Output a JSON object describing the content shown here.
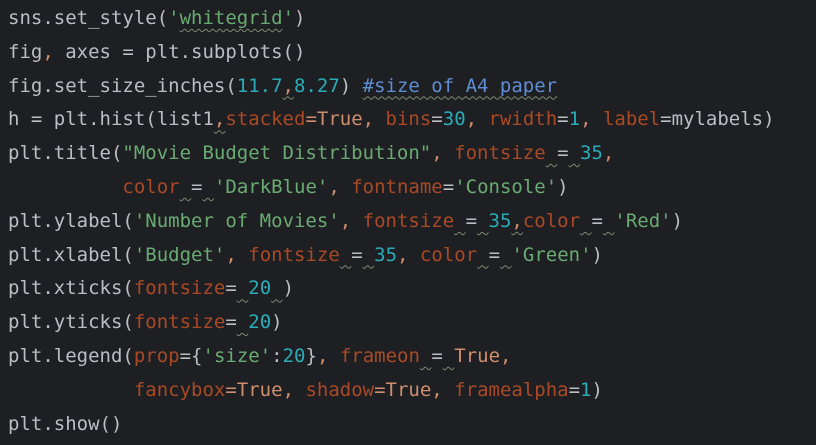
{
  "editor": {
    "lines": [
      {
        "tokens": [
          {
            "t": "sns.set_style(",
            "c": "plain"
          },
          {
            "t": "'",
            "c": "str"
          },
          {
            "t": "whitegrid",
            "c": "str",
            "u": "typo"
          },
          {
            "t": "'",
            "c": "str"
          },
          {
            "t": ")",
            "c": "plain"
          }
        ]
      },
      {
        "tokens": [
          {
            "t": "fig",
            "c": "plain"
          },
          {
            "t": ",",
            "c": "comma"
          },
          {
            "t": " axes = plt.subplots()",
            "c": "plain"
          }
        ]
      },
      {
        "tokens": [
          {
            "t": "fig.set_size_inches(",
            "c": "plain"
          },
          {
            "t": "11.7",
            "c": "num"
          },
          {
            "t": ",",
            "c": "comma",
            "u": "typo"
          },
          {
            "t": "8.27",
            "c": "num"
          },
          {
            "t": ") ",
            "c": "plain"
          },
          {
            "t": "#size of A4 paper",
            "c": "doc",
            "u": "typo"
          }
        ]
      },
      {
        "tokens": [
          {
            "t": "h = plt.hist(list1",
            "c": "plain"
          },
          {
            "t": ",",
            "c": "comma",
            "u": "typo"
          },
          {
            "t": "stacked",
            "c": "param"
          },
          {
            "t": "=True",
            "c": "kw"
          },
          {
            "t": ", ",
            "c": "comma"
          },
          {
            "t": "bins",
            "c": "param"
          },
          {
            "t": "=",
            "c": "plain"
          },
          {
            "t": "30",
            "c": "num"
          },
          {
            "t": ", ",
            "c": "comma"
          },
          {
            "t": "rwidth",
            "c": "param"
          },
          {
            "t": "=",
            "c": "plain"
          },
          {
            "t": "1",
            "c": "num"
          },
          {
            "t": ", ",
            "c": "comma"
          },
          {
            "t": "label",
            "c": "param"
          },
          {
            "t": "=mylabels)",
            "c": "plain"
          }
        ]
      },
      {
        "tokens": [
          {
            "t": "plt.title(",
            "c": "plain"
          },
          {
            "t": "\"Movie Budget Distribution\"",
            "c": "str"
          },
          {
            "t": ", ",
            "c": "comma"
          },
          {
            "t": "fontsize",
            "c": "param"
          },
          {
            "t": " ",
            "c": "plain",
            "u": "typo"
          },
          {
            "t": "=",
            "c": "plain"
          },
          {
            "t": " ",
            "c": "plain",
            "u": "typo"
          },
          {
            "t": "35",
            "c": "num"
          },
          {
            "t": ",",
            "c": "comma"
          }
        ]
      },
      {
        "tokens": [
          {
            "t": "          ",
            "c": "plain"
          },
          {
            "t": "color",
            "c": "param"
          },
          {
            "t": " ",
            "c": "plain",
            "u": "typo"
          },
          {
            "t": "=",
            "c": "plain"
          },
          {
            "t": " ",
            "c": "plain",
            "u": "typo"
          },
          {
            "t": "'DarkBlue'",
            "c": "str"
          },
          {
            "t": ", ",
            "c": "comma"
          },
          {
            "t": "fontname",
            "c": "param"
          },
          {
            "t": "=",
            "c": "plain"
          },
          {
            "t": "'Console'",
            "c": "str"
          },
          {
            "t": ")",
            "c": "plain"
          }
        ]
      },
      {
        "tokens": [
          {
            "t": "plt.ylabel(",
            "c": "plain"
          },
          {
            "t": "'Number of Movies'",
            "c": "str"
          },
          {
            "t": ", ",
            "c": "comma"
          },
          {
            "t": "fontsize",
            "c": "param"
          },
          {
            "t": " ",
            "c": "plain",
            "u": "typo"
          },
          {
            "t": "=",
            "c": "plain"
          },
          {
            "t": " ",
            "c": "plain",
            "u": "typo"
          },
          {
            "t": "35",
            "c": "num"
          },
          {
            "t": ",",
            "c": "comma",
            "u": "typo"
          },
          {
            "t": "color",
            "c": "param"
          },
          {
            "t": " ",
            "c": "plain",
            "u": "typo"
          },
          {
            "t": "=",
            "c": "plain"
          },
          {
            "t": " ",
            "c": "plain",
            "u": "typo"
          },
          {
            "t": "'Red'",
            "c": "str"
          },
          {
            "t": ")",
            "c": "plain"
          }
        ]
      },
      {
        "tokens": [
          {
            "t": "plt.xlabel(",
            "c": "plain"
          },
          {
            "t": "'Budget'",
            "c": "str"
          },
          {
            "t": ", ",
            "c": "comma"
          },
          {
            "t": "fontsize",
            "c": "param"
          },
          {
            "t": " ",
            "c": "plain",
            "u": "typo"
          },
          {
            "t": "=",
            "c": "plain"
          },
          {
            "t": " ",
            "c": "plain",
            "u": "typo"
          },
          {
            "t": "35",
            "c": "num"
          },
          {
            "t": ", ",
            "c": "comma"
          },
          {
            "t": "color",
            "c": "param"
          },
          {
            "t": " ",
            "c": "plain",
            "u": "typo"
          },
          {
            "t": "=",
            "c": "plain"
          },
          {
            "t": " ",
            "c": "plain",
            "u": "typo"
          },
          {
            "t": "'Green'",
            "c": "str"
          },
          {
            "t": ")",
            "c": "plain"
          }
        ]
      },
      {
        "tokens": [
          {
            "t": "plt.xticks(",
            "c": "plain"
          },
          {
            "t": "fontsize",
            "c": "param"
          },
          {
            "t": "=",
            "c": "plain"
          },
          {
            "t": " ",
            "c": "plain",
            "u": "typo"
          },
          {
            "t": "20",
            "c": "num"
          },
          {
            "t": " ",
            "c": "plain",
            "u": "typo"
          },
          {
            "t": ")",
            "c": "plain"
          }
        ]
      },
      {
        "tokens": [
          {
            "t": "plt.yticks(",
            "c": "plain"
          },
          {
            "t": "fontsize",
            "c": "param"
          },
          {
            "t": "=",
            "c": "plain"
          },
          {
            "t": " ",
            "c": "plain",
            "u": "typo"
          },
          {
            "t": "20",
            "c": "num"
          },
          {
            "t": ")",
            "c": "plain"
          }
        ]
      },
      {
        "tokens": [
          {
            "t": "plt.legend(",
            "c": "plain"
          },
          {
            "t": "prop",
            "c": "param"
          },
          {
            "t": "={",
            "c": "plain"
          },
          {
            "t": "'size'",
            "c": "str"
          },
          {
            "t": ":",
            "c": "plain"
          },
          {
            "t": "20",
            "c": "num"
          },
          {
            "t": "}",
            "c": "plain"
          },
          {
            "t": ", ",
            "c": "comma"
          },
          {
            "t": "frameon",
            "c": "param"
          },
          {
            "t": " ",
            "c": "plain",
            "u": "typo"
          },
          {
            "t": "=",
            "c": "plain"
          },
          {
            "t": " ",
            "c": "plain",
            "u": "typo"
          },
          {
            "t": "True",
            "c": "kw"
          },
          {
            "t": ",",
            "c": "comma"
          }
        ]
      },
      {
        "tokens": [
          {
            "t": "           ",
            "c": "plain"
          },
          {
            "t": "fancybox",
            "c": "param"
          },
          {
            "t": "=True",
            "c": "kw"
          },
          {
            "t": ", ",
            "c": "comma"
          },
          {
            "t": "shadow",
            "c": "param"
          },
          {
            "t": "=True",
            "c": "kw"
          },
          {
            "t": ", ",
            "c": "comma"
          },
          {
            "t": "framealpha",
            "c": "param"
          },
          {
            "t": "=",
            "c": "plain"
          },
          {
            "t": "1",
            "c": "num"
          },
          {
            "t": ")",
            "c": "plain"
          }
        ]
      },
      {
        "tokens": [
          {
            "t": "plt.show()",
            "c": "plain"
          }
        ]
      }
    ]
  },
  "colors": {
    "background": "#1e1f22",
    "plain": "#bcbec4",
    "param": "#aa4926",
    "keyword": "#cf8e6d",
    "string": "#6aab73",
    "number": "#2aacb8",
    "comment": "#5f8dd3",
    "typo_underline": "#7c8b72"
  }
}
